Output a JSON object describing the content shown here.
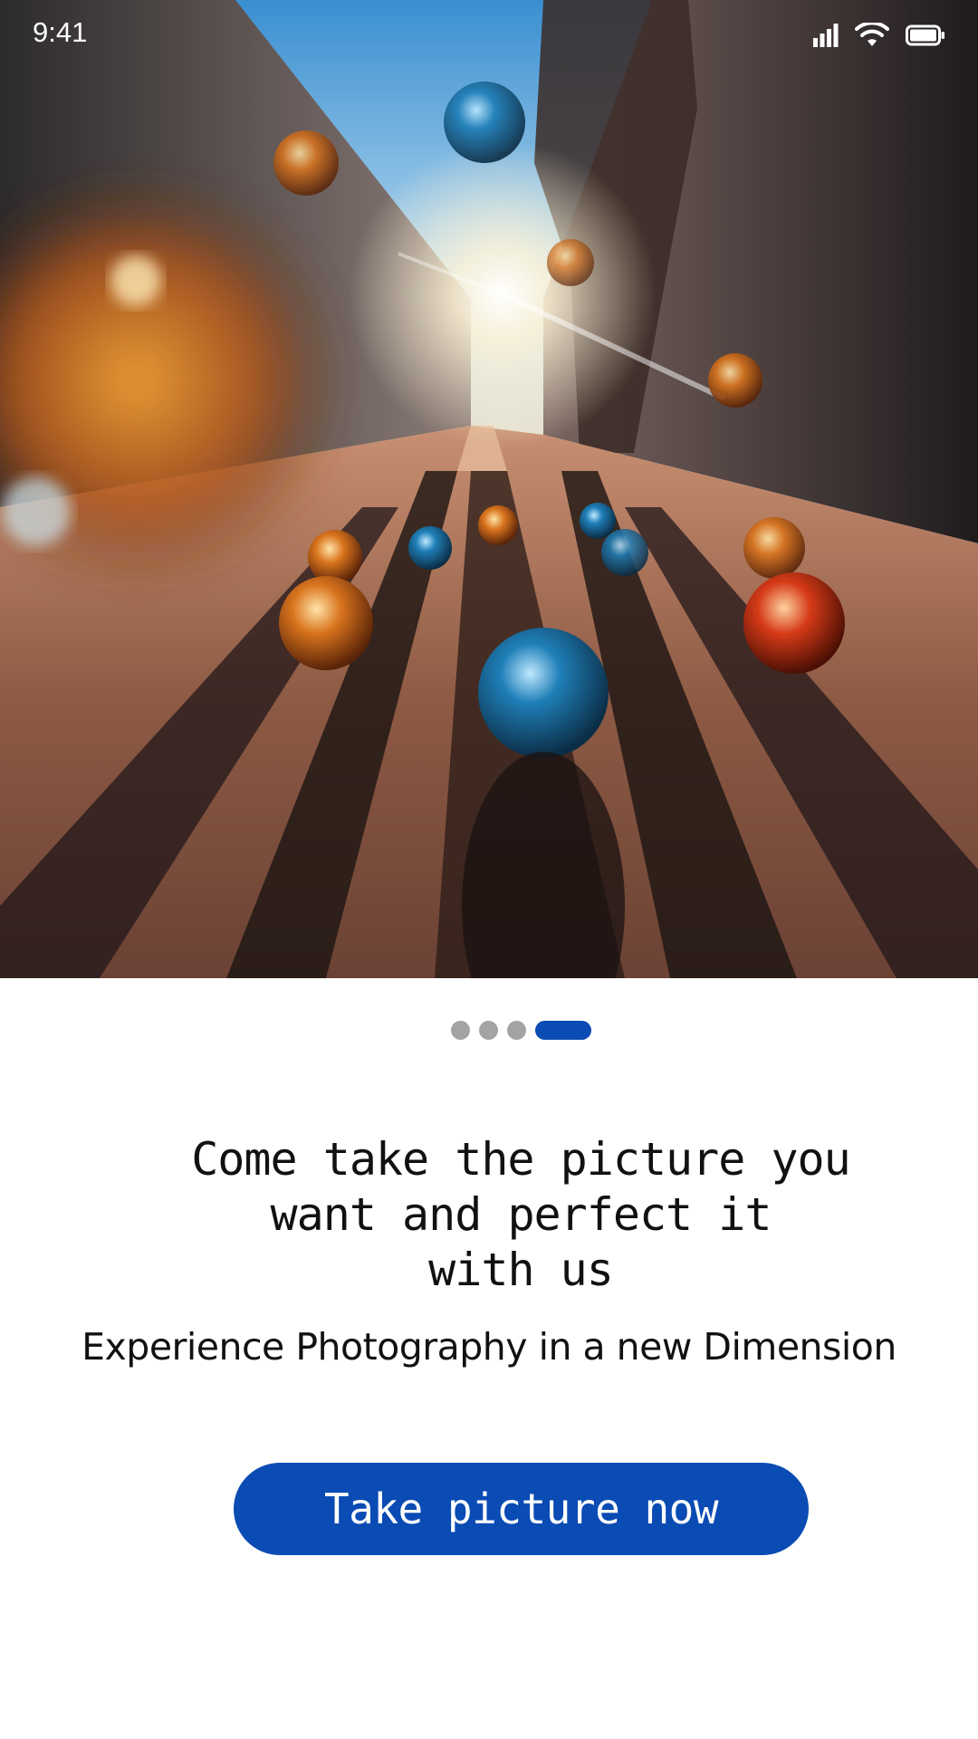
{
  "status_bar": {
    "time": "9:41",
    "icons": [
      "signal-icon",
      "wifi-icon",
      "battery-icon"
    ]
  },
  "hero": {
    "image": "photo-marbles-on-street"
  },
  "pager": {
    "total": 4,
    "active_index": 3
  },
  "content": {
    "headline_lines": [
      "Come take the picture you",
      "want and perfect it",
      "with us"
    ],
    "subheadline": "Experience Photography in a new Dimension"
  },
  "cta": {
    "label": "Take picture now"
  },
  "colors": {
    "accent": "#0a4bb4",
    "dot_inactive": "#a3a3a3",
    "text": "#111111",
    "background": "#ffffff"
  }
}
